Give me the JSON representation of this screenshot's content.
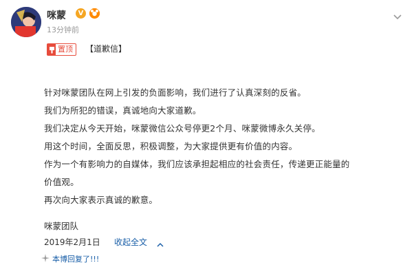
{
  "user": {
    "name": "咪蒙",
    "verified_badge": "V",
    "member_badge": "dot"
  },
  "post": {
    "timestamp": "13分钟前",
    "pinned_label": "置顶",
    "tag": "【道歉信】",
    "body_lines": [
      "针对咪蒙团队在网上引发的负面影响，我们进行了认真深刻的反省。",
      "我们为所犯的错误，真诚地向大家道歉。",
      "我们决定从今天开始，咪蒙微信公众号停更2个月、咪蒙微博永久关停。",
      "用这个时间，全面反思，积极调整，为大家提供更有价值的内容。",
      "作为一个有影响力的自媒体，我们应该承担起相应的社会责任，传递更正能量的",
      "价值观。",
      "再次向大家表示真诚的歉意。"
    ],
    "signature": "咪蒙团队",
    "date": "2019年2月1日",
    "collapse_label": "收起全文",
    "reply_label": "本博回复了!!!"
  },
  "colors": {
    "accent_red": "#e74c3c",
    "link_blue": "#1a5fa8",
    "muted_gray": "#9a9a9a",
    "badge_orange": "#f5a623"
  },
  "icons": {
    "pin": "pin-icon",
    "more": "chevron-down-icon",
    "collapse": "caret-up-icon",
    "reply": "sparkle-icon"
  }
}
